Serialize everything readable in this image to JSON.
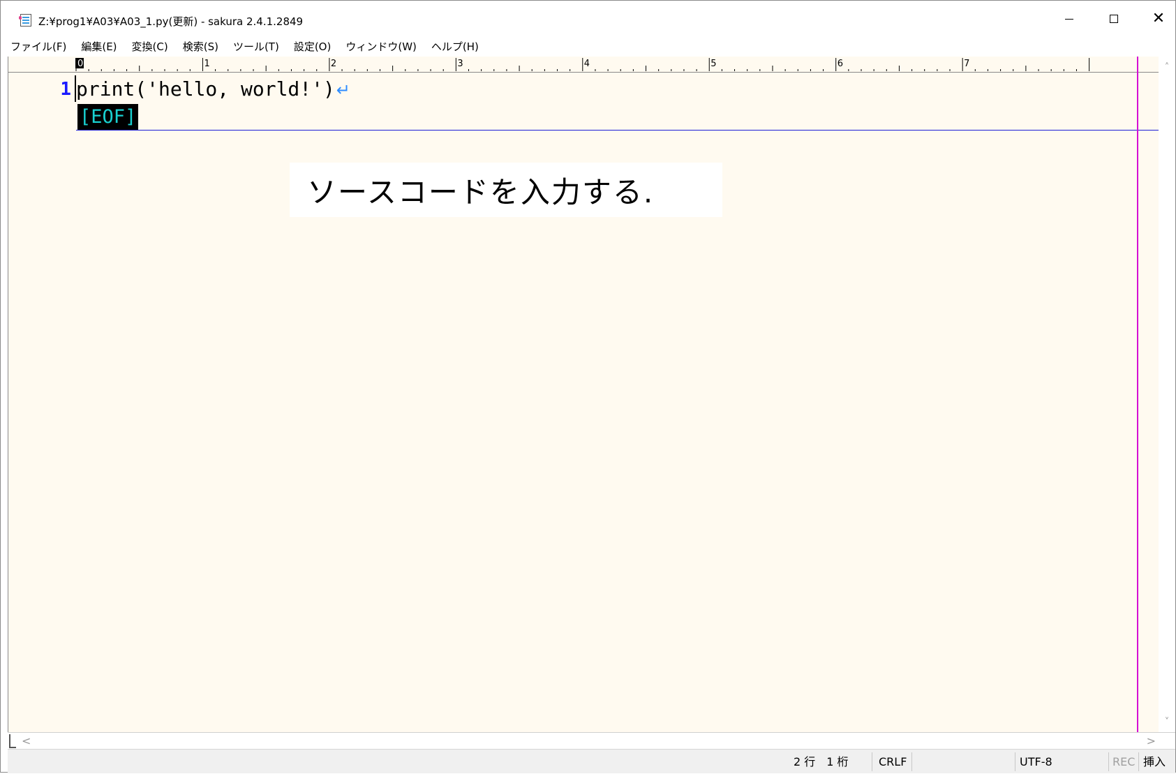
{
  "window": {
    "title": "Z:¥prog1¥A03¥A03_1.py(更新) - sakura 2.4.1.2849"
  },
  "menu": [
    {
      "label": "ファイル(F)"
    },
    {
      "label": "編集(E)"
    },
    {
      "label": "変換(C)"
    },
    {
      "label": "検索(S)"
    },
    {
      "label": "ツール(T)"
    },
    {
      "label": "設定(O)"
    },
    {
      "label": "ウィンドウ(W)"
    },
    {
      "label": "ヘルプ(H)"
    }
  ],
  "ruler": {
    "labels": [
      "0",
      "1",
      "2",
      "3",
      "4",
      "5",
      "6",
      "7"
    ]
  },
  "editor": {
    "line_number": "1",
    "code": "print('hello, world!')",
    "eof_marker": "[EOF]"
  },
  "annotation": {
    "text": "ソースコードを入力する."
  },
  "status": {
    "position": "2 行　1 桁",
    "line_ending": "CRLF",
    "encoding": "UTF-8",
    "rec": "REC",
    "mode": "挿入"
  },
  "colors": {
    "editor_bg": "#fffaf0",
    "line_number": "#1a1aff",
    "eof_fg": "#19d0d0",
    "margin_line": "#d40fd4",
    "underline": "#1b1bd6"
  },
  "icons": [
    "app-icon",
    "minimize-icon",
    "maximize-icon",
    "close-icon",
    "return-arrow-icon",
    "scroll-up-icon",
    "scroll-down-icon",
    "scroll-left-icon",
    "scroll-right-icon"
  ]
}
